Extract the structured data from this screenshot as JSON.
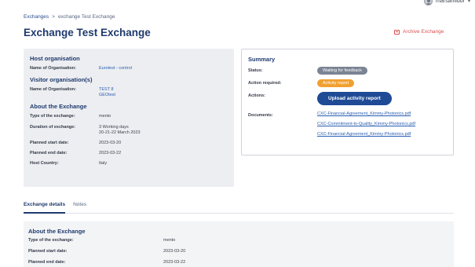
{
  "user": {
    "name": "marsamidor"
  },
  "breadcrumb": {
    "root": "Exchanges",
    "separator": ">",
    "current": "exchange Test Exchange"
  },
  "page": {
    "title": "Exchange Test Exchange",
    "archive_label": "Archive Exchange"
  },
  "host": {
    "title": "Host organisation",
    "org_label": "Name of Organisation:",
    "org_value": "Eurotest - control",
    "visitor_title": "Visitor organisation(s)",
    "visitor_label": "Name of Organisation:",
    "visitor_value_1": "TEST 8",
    "visitor_value_2": "GEOtest"
  },
  "about": {
    "title": "About the Exchange",
    "type_label": "Type of the exchange:",
    "type_value": "mento",
    "duration_label": "Duration of exchange:",
    "duration_value_1": "3 Working days",
    "duration_value_2": "20-21-22 March 2023",
    "start_label": "Planned start date:",
    "start_value": "2023-03-20",
    "end_label": "Planned end date:",
    "end_value": "2023-03-22",
    "country_label": "Host Country:",
    "country_value": "Italy"
  },
  "summary": {
    "title": "Summary",
    "status_label": "Status:",
    "status_value": "Waiting for feedback",
    "action_label": "Action required:",
    "action_value": "Activity report",
    "actions_label": "Actions:",
    "upload_button": "Upload activity report",
    "documents_label": "Documents:",
    "documents": [
      "CXC-Financial-Agreement_Kimmy-Photonics.pdf",
      "CXC-Commitment-to-Quality_Kimmy-Photonics.pdf",
      "CXC-Financial-Agreement_Kimmy-Photonics.pdf"
    ],
    "colors": {
      "status": "#7b8494",
      "action": "#f0a030",
      "button": "#1e4a96"
    }
  },
  "tabs": {
    "details": "Exchange details",
    "notes": "Notes"
  },
  "details": {
    "title": "About the Exchange",
    "type_label": "Type of the exchange:",
    "type_value": "mento",
    "start_label": "Planned start date:",
    "start_value": "2023-03-20",
    "end_label": "Planned end date:",
    "end_value": "2023-03-22"
  }
}
